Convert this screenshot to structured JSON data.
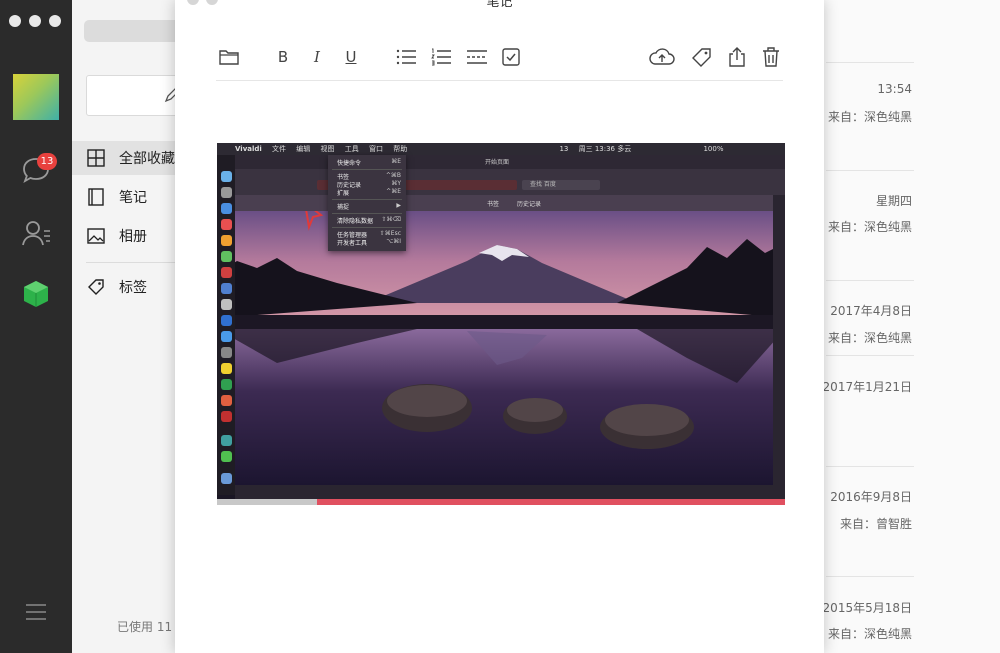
{
  "rail": {
    "badge_count": "13"
  },
  "nav": {
    "items": [
      {
        "label": "全部收藏"
      },
      {
        "label": "笔记"
      },
      {
        "label": "相册"
      },
      {
        "label": "标签"
      }
    ],
    "storage_text": "已使用 11"
  },
  "editor": {
    "window_title": "笔记",
    "toolbar": {
      "bold": "B",
      "italic": "I",
      "underline": "U"
    },
    "embedded_screenshot": {
      "menubar": [
        "Vivaldi",
        "文件",
        "编辑",
        "视图",
        "工具",
        "窗口",
        "帮助"
      ],
      "menubar_right": [
        "13",
        "周三 13:36 多云",
        "100%"
      ],
      "start_page": "开始页面",
      "search_placeholder": "查找 百度",
      "bookmarks_label": "书签",
      "history_label": "历史记录",
      "tools_menu": [
        {
          "label": "快捷命令",
          "key": "⌘E"
        },
        {
          "label": "书签",
          "key": "^⌘B"
        },
        {
          "label": "历史记录",
          "key": "⌘Y"
        },
        {
          "label": "扩展",
          "key": "^⌘E"
        },
        {
          "label": "捕捉",
          "key": "▶"
        },
        {
          "label": "清除隐私数据",
          "key": "⇧⌘⌫"
        },
        {
          "label": "任务管理器",
          "key": "⇧⌘Esc"
        },
        {
          "label": "开发者工具",
          "key": "⌥⌘I"
        }
      ]
    }
  },
  "list": {
    "items": [
      {
        "date": "13:54",
        "source": "来自：深色纯黑"
      },
      {
        "date": "星期四",
        "source": "来自：深色纯黑"
      },
      {
        "date": "2017年4月8日",
        "source": "来自：深色纯黑"
      },
      {
        "date": "2017年1月21日",
        "source": ""
      },
      {
        "date": "2016年9月8日",
        "source": "来自：曾智胜"
      },
      {
        "date": "2015年5月18日",
        "source": "来自：深色纯黑"
      }
    ]
  },
  "colors": {
    "rail_bg": "#2b2b2b",
    "badge": "#e8413e",
    "nav_bg": "#f4f4f4",
    "active_item_bg": "#e2e2e2"
  }
}
